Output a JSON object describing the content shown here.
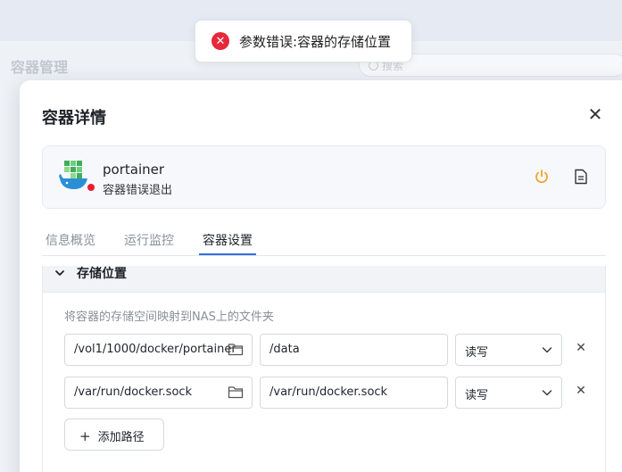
{
  "toast": {
    "message": "参数错误:容器的存储位置",
    "icon": "error-icon",
    "color": "#e5293a"
  },
  "background": {
    "title": "容器管理",
    "search_placeholder": "搜索"
  },
  "modal": {
    "title": "容器详情",
    "container": {
      "name": "portainer",
      "status": "容器错误退出",
      "status_color": "#e81c2e"
    },
    "tabs": [
      {
        "label": "信息概览",
        "active": false
      },
      {
        "label": "运行监控",
        "active": false
      },
      {
        "label": "容器设置",
        "active": true
      }
    ],
    "section": {
      "title": "存储位置",
      "description": "将容器的存储空间映射到NAS上的文件夹",
      "mounts": [
        {
          "host_path": "/vol1/1000/docker/portainer",
          "container_path": "/data",
          "permission": "读写"
        },
        {
          "host_path": "/var/run/docker.sock",
          "container_path": "/var/run/docker.sock",
          "permission": "读写"
        }
      ],
      "add_button": "添加路径"
    }
  },
  "colors": {
    "accent": "#2e6fdb",
    "warning": "#f0a020"
  }
}
